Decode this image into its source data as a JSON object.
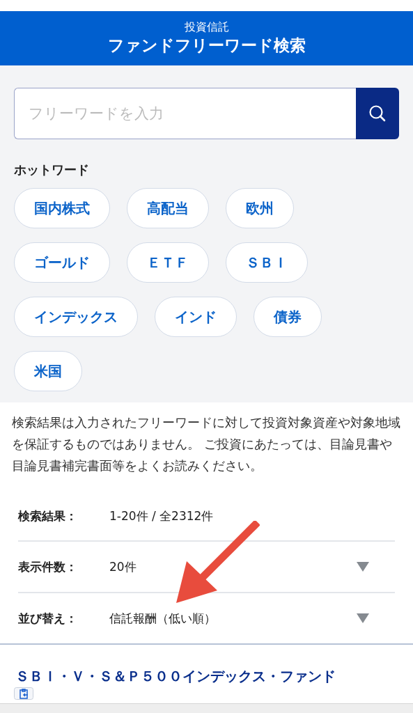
{
  "header": {
    "category": "投資信託",
    "title": "ファンドフリーワード検索"
  },
  "search": {
    "placeholder": "フリーワードを入力"
  },
  "hot_words": {
    "title": "ホットワード",
    "chips": [
      "国内株式",
      "高配当",
      "欧州",
      "ゴールド",
      "ＥＴＦ",
      "ＳＢＩ",
      "インデックス",
      "インド",
      "債券",
      "米国"
    ]
  },
  "disclaimer": "検索結果は入力されたフリーワードに対して投資対象資産や対象地域を保証するものではありません。 ご投資にあたっては、目論見書や目論見書補完書面等をよくお読みください。",
  "results": [
    {
      "label": "検索結果：",
      "value": "1-20件 / 全2312件",
      "kind": "text"
    },
    {
      "label": "表示件数：",
      "value": "20件",
      "kind": "select"
    },
    {
      "label": "並び替え：",
      "value": "信託報酬（低い順）",
      "kind": "select"
    }
  ],
  "fund": {
    "name": "ＳＢＩ・Ｖ・Ｓ＆Ｐ５００インデックス・ファンド"
  }
}
